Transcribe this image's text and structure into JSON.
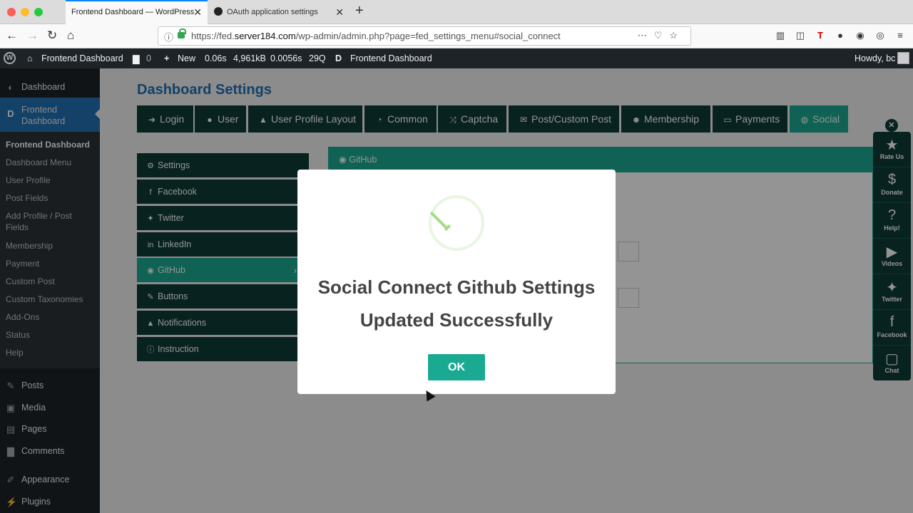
{
  "browser": {
    "tabs": [
      {
        "title": "Frontend Dashboard — WordPress",
        "active": true
      },
      {
        "title": "OAuth application settings",
        "active": false
      }
    ],
    "url_prefix": "https://fed.",
    "url_domain": "server184.com",
    "url_path": "/wp-admin/admin.php?page=fed_settings_menu#social_connect"
  },
  "adminbar": {
    "site_name": "Frontend Dashboard",
    "comments_count": "0",
    "new_label": "New",
    "stats_time": "0.06s",
    "stats_mem": "4,961kB",
    "stats_db": "0.0056s",
    "stats_queries": "29Q",
    "plugin_name": "Frontend Dashboard",
    "howdy": "Howdy, bc"
  },
  "sidebar": {
    "dashboard": "Dashboard",
    "frontend_dashboard": "Frontend Dashboard",
    "submenu": [
      "Frontend Dashboard",
      "Dashboard Menu",
      "User Profile",
      "Post Fields",
      "Add Profile / Post Fields",
      "Membership",
      "Payment",
      "Custom Post",
      "Custom Taxonomies",
      "Add-Ons",
      "Status",
      "Help"
    ],
    "bottom": [
      "Posts",
      "Media",
      "Pages",
      "Comments",
      "Appearance",
      "Plugins"
    ]
  },
  "main": {
    "title": "Dashboard Settings",
    "tabs": [
      "Login",
      "User",
      "User Profile Layout",
      "Common",
      "Captcha",
      "Post/Custom Post",
      "Membership",
      "Payments",
      "Social"
    ],
    "subnav": [
      "Settings",
      "Facebook",
      "Twitter",
      "LinkedIn",
      "GitHub",
      "Buttons",
      "Notifications",
      "Instruction"
    ],
    "panel_title": "GitHub"
  },
  "rightbar": [
    "Rate Us",
    "Donate",
    "Help!",
    "Videos",
    "Twitter",
    "Facebook",
    "Chat"
  ],
  "modal": {
    "line1": "Social Connect Github Settings",
    "line2": "Updated Successfully",
    "ok": "OK"
  },
  "colors": {
    "accent": "#1aaa92",
    "dark_green": "#0e3b36",
    "wp_blue": "#2271b1",
    "wp_dark": "#1d2327"
  }
}
